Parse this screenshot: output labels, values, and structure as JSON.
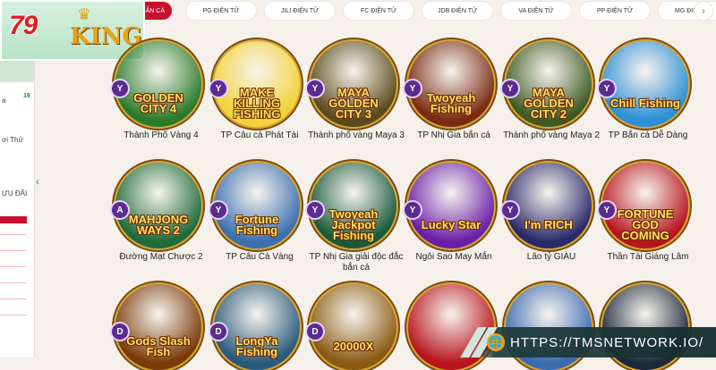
{
  "logo": {
    "number": "79",
    "word": "KING",
    "crown": "♛"
  },
  "tabs": [
    {
      "label": "BẮN CÁ",
      "active": true
    },
    {
      "label": "PG ĐIỆN TỬ"
    },
    {
      "label": "JILI ĐIỆN TỬ"
    },
    {
      "label": "FC ĐIỆN TỬ"
    },
    {
      "label": "JDB ĐIỆN TỬ"
    },
    {
      "label": "VA ĐIỆN TỬ"
    },
    {
      "label": "PP ĐIỆN TỬ"
    },
    {
      "label": "MG ĐIỆN TỬ"
    }
  ],
  "tab_next_icon": "›",
  "sidebar": {
    "text_a": "a",
    "badge": "19",
    "text_b": "ơi Thử",
    "text_c": "ƯU ĐÃI",
    "chevron": "‹"
  },
  "games": [
    {
      "art_title": "GOLDEN CITY 4",
      "provider": "Y",
      "name": "Thành Phố Vàng 4",
      "color": "#2a7a2a"
    },
    {
      "art_title": "MAKE KILLING FISHING",
      "provider": "Y",
      "name": "TP Câu cá Phát Tài",
      "color": "#f3d23a"
    },
    {
      "art_title": "MAYA GOLDEN CITY 3",
      "provider": "Y",
      "name": "Thành phố vàng Maya 3",
      "color": "#5a4a1c"
    },
    {
      "art_title": "Twoyeah Fishing",
      "provider": "Y",
      "name": "TP Nhị Gia bắn cá",
      "color": "#7a2a12"
    },
    {
      "art_title": "MAYA GOLDEN CITY 2",
      "provider": "Y",
      "name": "Thành phố vàng Maya 2",
      "color": "#3e5a22"
    },
    {
      "art_title": "Chill Fishing",
      "provider": "Y",
      "name": "TP Bắn cá Dễ Dàng",
      "color": "#2d8fd6"
    },
    {
      "art_title": "MAHJONG WAYS 2",
      "provider": "A",
      "name": "Đường Mạt Chược 2",
      "color": "#1f6b3a"
    },
    {
      "art_title": "Fortune Fishing",
      "provider": "Y",
      "name": "TP Câu Cá Vàng",
      "color": "#3b6fb0"
    },
    {
      "art_title": "Twoyeah Jackpot Fishing",
      "provider": "Y",
      "name": "TP Nhị Gia giải độc đắc bắn cá",
      "color": "#1a5a3a"
    },
    {
      "art_title": "Lucky Star",
      "provider": "Y",
      "name": "Ngôi Sao May Mắn",
      "color": "#6a1fa8"
    },
    {
      "art_title": "I'm RICH",
      "provider": "Y",
      "name": "Lão tỷ GIÀU",
      "color": "#2a2a6a"
    },
    {
      "art_title": "FORTUNE GOD COMING",
      "provider": "Y",
      "name": "Thần Tài Giáng Lâm",
      "color": "#b8141d"
    },
    {
      "art_title": "Gods Slash Fish",
      "provider": "D",
      "name": "",
      "color": "#7a3a0a"
    },
    {
      "art_title": "LongYa Fishing",
      "provider": "D",
      "name": "",
      "color": "#2a5a7a"
    },
    {
      "art_title": "20000X",
      "provider": "D",
      "name": "",
      "color": "#8a5a12"
    },
    {
      "art_title": "",
      "provider": "",
      "name": "",
      "color": "#b8141d"
    },
    {
      "art_title": "",
      "provider": "",
      "name": "",
      "color": "#3a6ab0"
    },
    {
      "art_title": "",
      "provider": "",
      "name": "",
      "color": "#1b2a3a"
    }
  ],
  "watermark": {
    "icon": "🌐",
    "text": "HTTPS://TMSNETWORK.IO/"
  }
}
